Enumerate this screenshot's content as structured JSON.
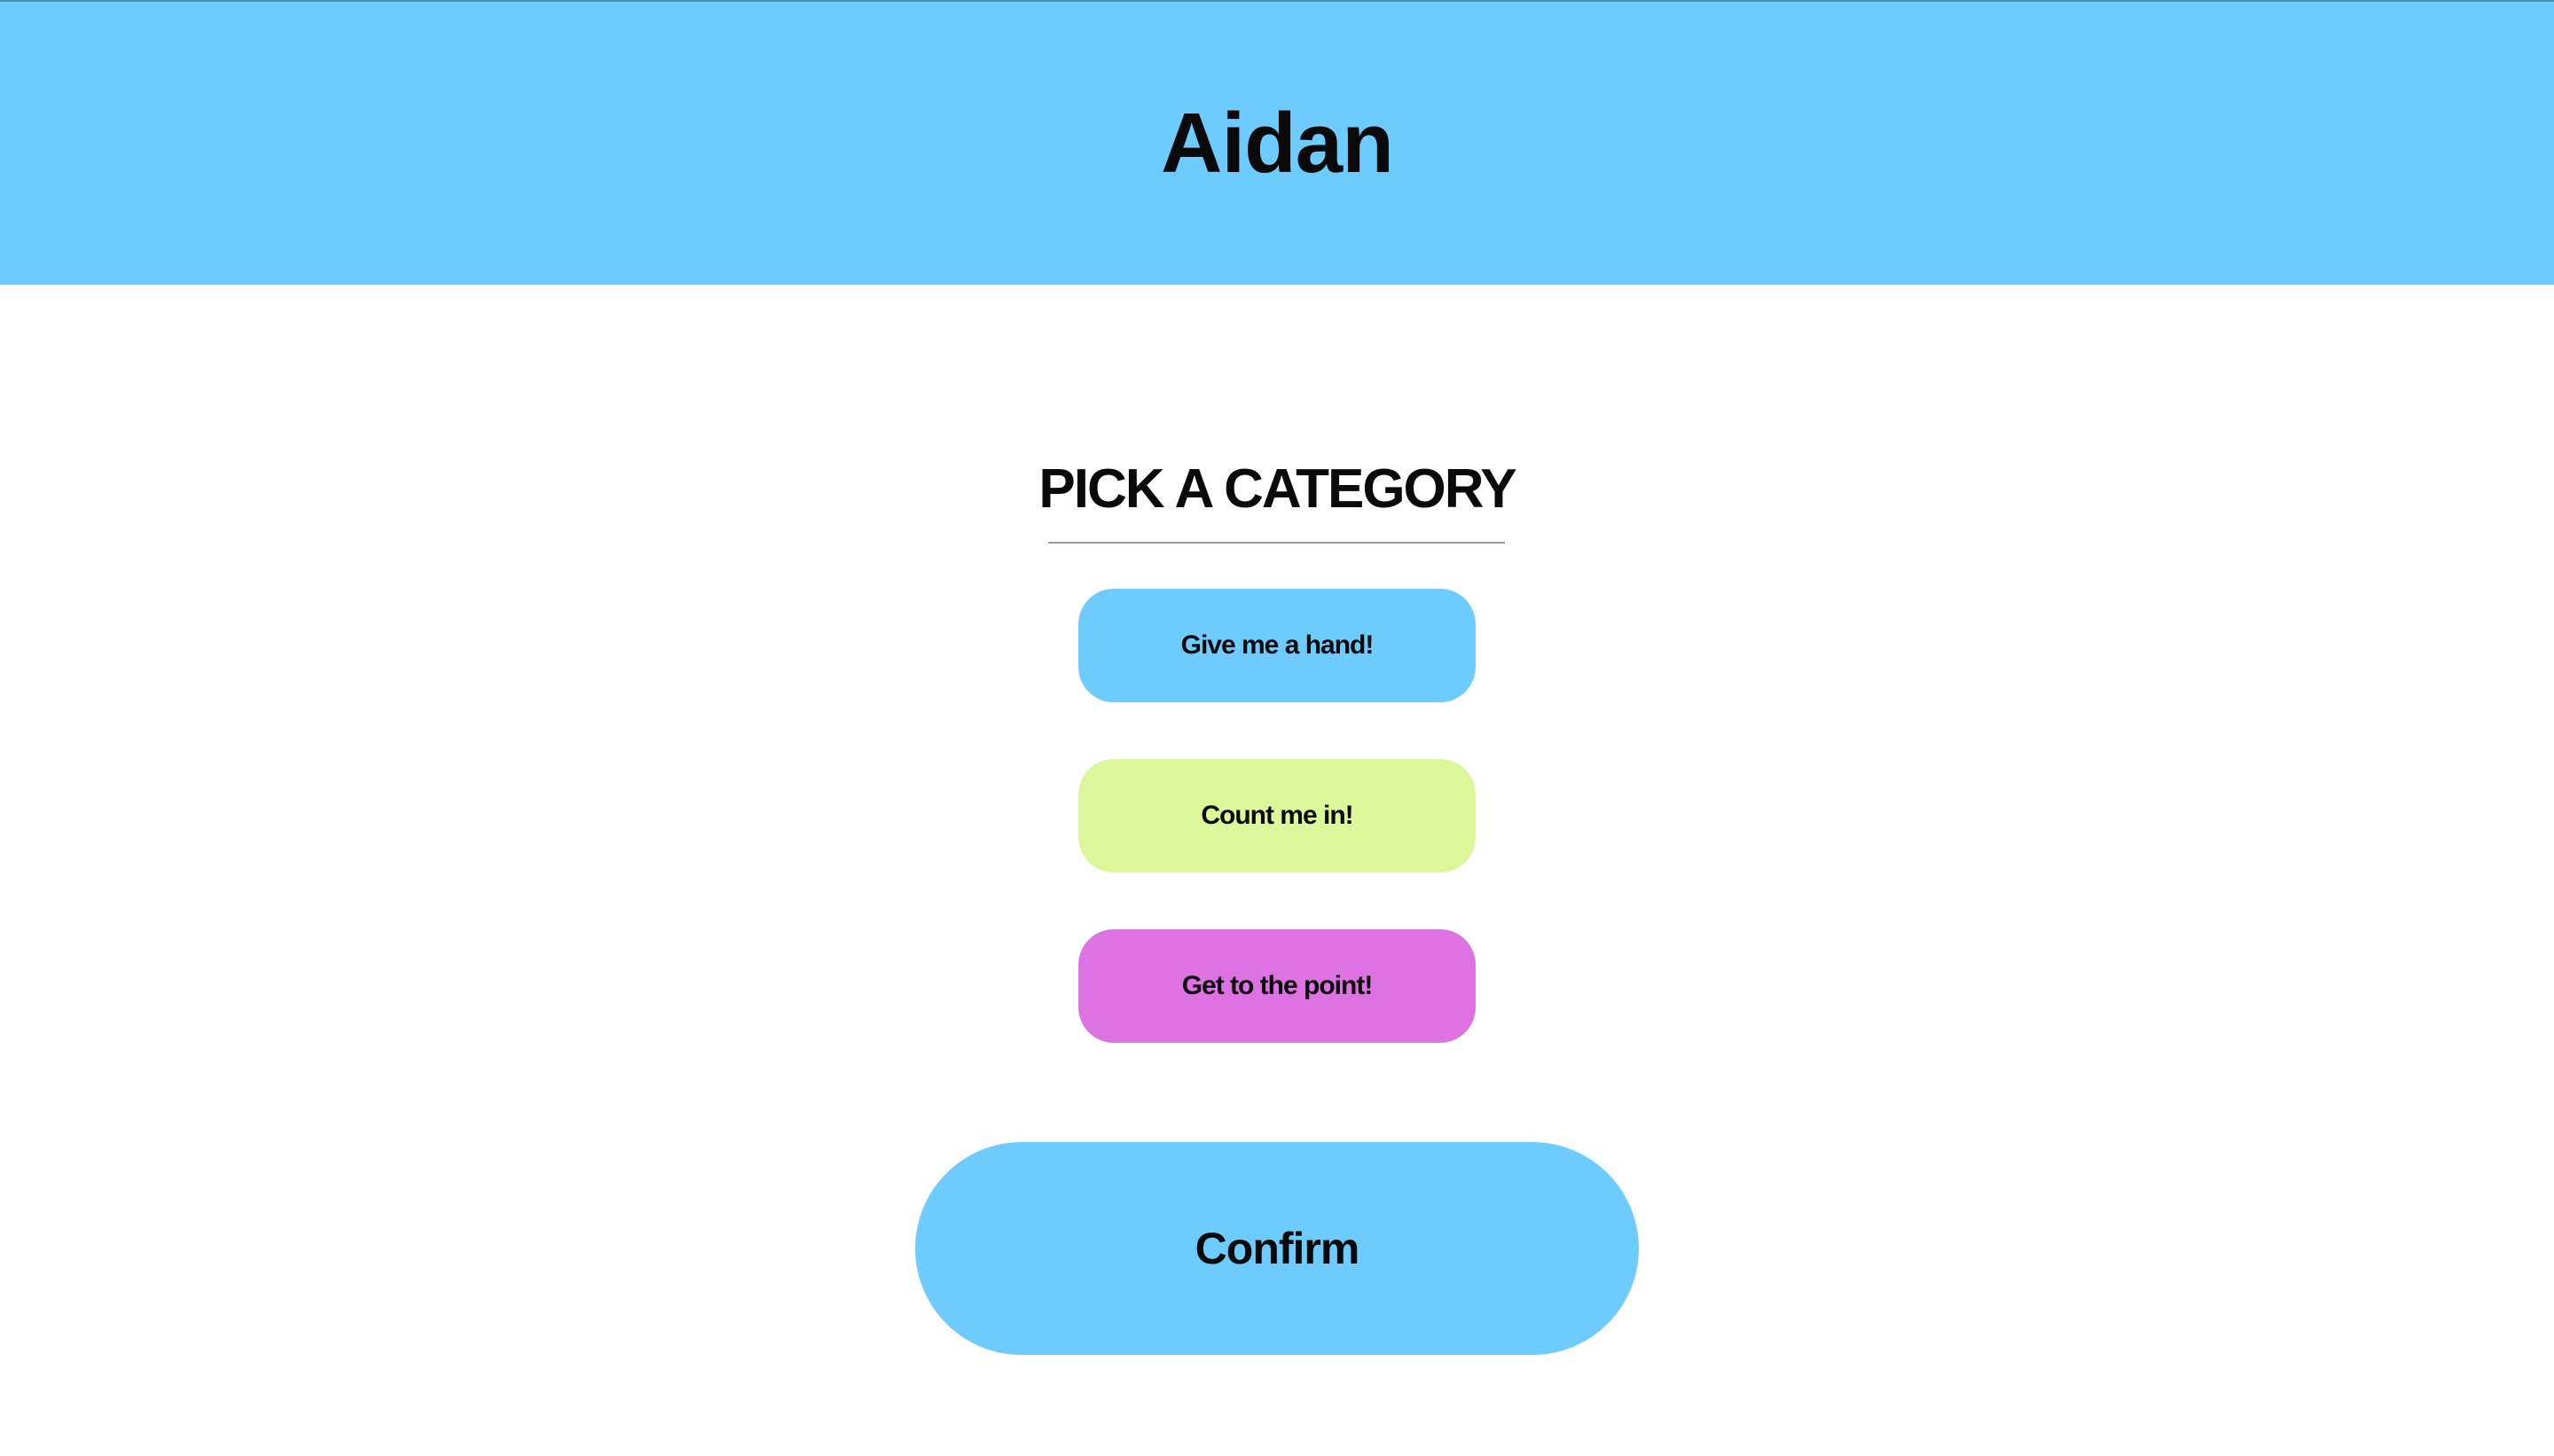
{
  "header": {
    "title": "Aidan",
    "background_color": "#6ecbfe"
  },
  "category_section": {
    "heading": "PICK A CATEGORY",
    "options": [
      {
        "label": "Give me a hand!",
        "color": "#6ecbfe"
      },
      {
        "label": "Count me in!",
        "color": "#dcf79a"
      },
      {
        "label": "Get to the point!",
        "color": "#df72e3"
      }
    ]
  },
  "confirm": {
    "label": "Confirm",
    "color": "#6ecbfe"
  }
}
